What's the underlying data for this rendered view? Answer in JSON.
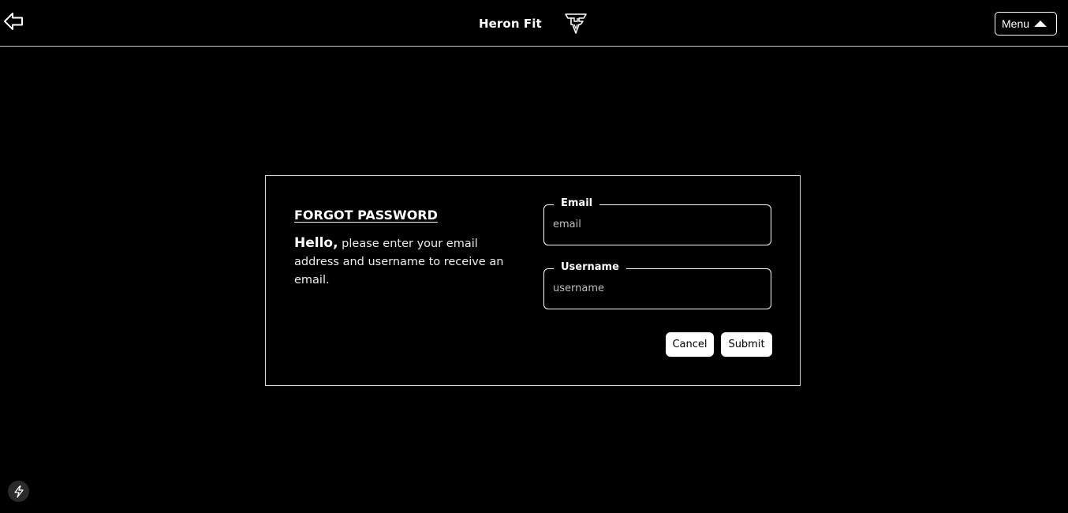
{
  "header": {
    "title": "Heron Fit",
    "logo_text": "HF",
    "menu_label": "Menu"
  },
  "forgot_password": {
    "title": "FORGOT PASSWORD",
    "hello": "Hello,",
    "message": "please enter your email address and username to receive an email.",
    "email": {
      "label": "Email",
      "placeholder": "email",
      "value": ""
    },
    "username": {
      "label": "Username",
      "placeholder": "username",
      "value": ""
    },
    "cancel_label": "Cancel",
    "submit_label": "Submit"
  },
  "icons": {
    "back": "arrow-left-icon",
    "menu_caret": "caret-up-icon",
    "badge": "lightning-bolt-icon"
  },
  "colors": {
    "background": "#000000",
    "foreground": "#ffffff",
    "badge": "#2b2b2b"
  }
}
